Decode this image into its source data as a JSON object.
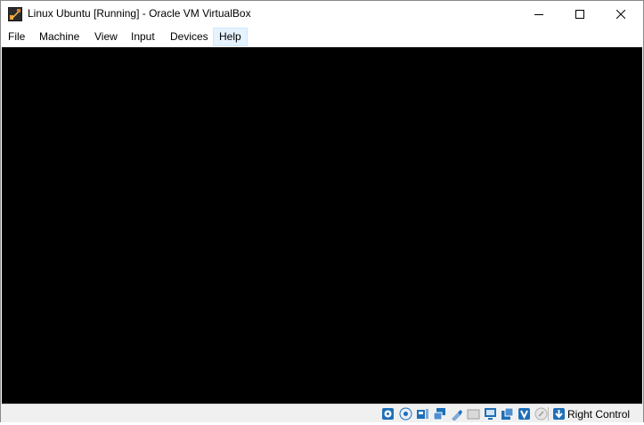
{
  "window": {
    "title": "Linux Ubuntu [Running] - Oracle VM VirtualBox"
  },
  "window_controls": {
    "minimize": "minimize-icon",
    "maximize": "maximize-icon",
    "close": "close-icon"
  },
  "menu": {
    "items": [
      {
        "label": "File"
      },
      {
        "label": "Machine"
      },
      {
        "label": "View"
      },
      {
        "label": "Input"
      },
      {
        "label": "Devices"
      },
      {
        "label": "Help"
      }
    ],
    "highlighted": "Help"
  },
  "statusbar": {
    "icons": [
      "hard-disk-icon",
      "optical-drive-icon",
      "audio-icon",
      "network-icon",
      "usb-icon",
      "shared-folders-icon",
      "display-icon",
      "video-capture-icon",
      "virtualization-icon",
      "mouse-integration-icon"
    ],
    "host_key_label": "Right Control"
  },
  "colors": {
    "screen": "#000000",
    "menu_highlight": "#e5f3ff",
    "status_icon_blue": "#1e6fb8"
  }
}
